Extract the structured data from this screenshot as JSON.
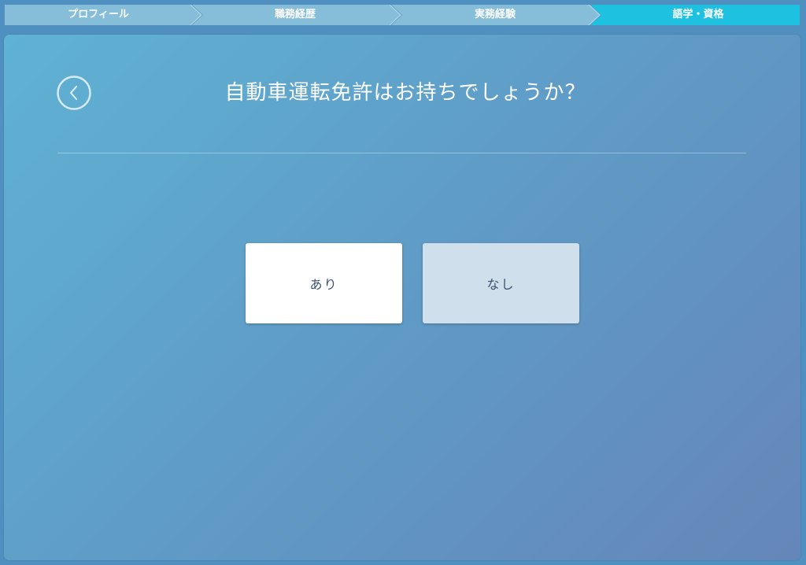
{
  "stepper": {
    "steps": [
      {
        "label": "プロフィール",
        "state": "completed"
      },
      {
        "label": "職務経歴",
        "state": "completed"
      },
      {
        "label": "実務経験",
        "state": "completed"
      },
      {
        "label": "語学・資格",
        "state": "current"
      }
    ],
    "colors": {
      "completed": "#86bdd8",
      "current": "#1fc1e0"
    }
  },
  "question": {
    "back_icon": "chevron-left-icon",
    "title": "自動車運転免許はお持ちでしょうか？"
  },
  "options": {
    "yes_label": "あり",
    "no_label": "なし"
  }
}
